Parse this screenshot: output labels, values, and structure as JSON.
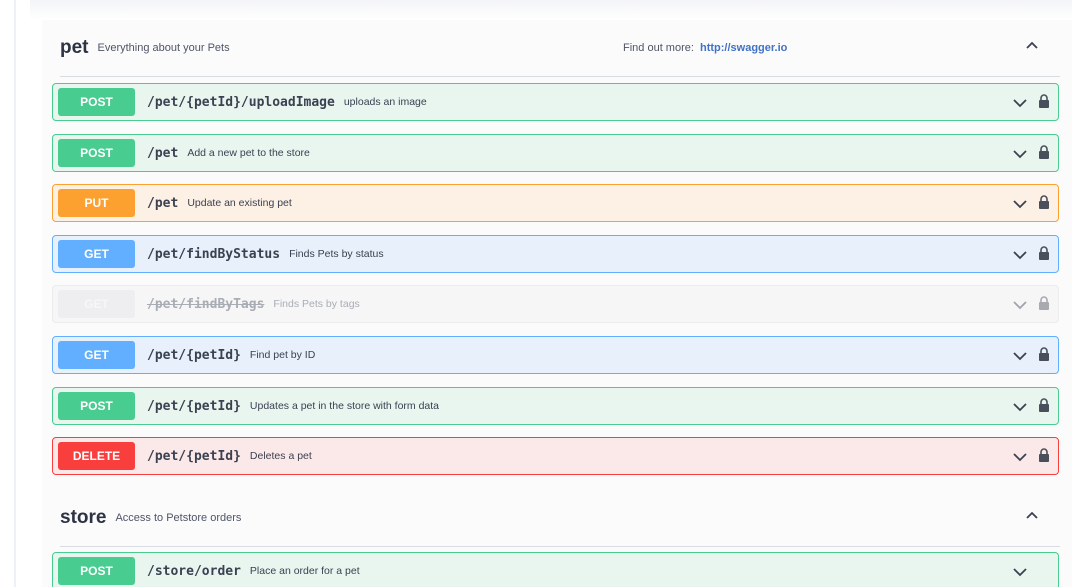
{
  "colors": {
    "post": "#49cc90",
    "put": "#fca130",
    "get": "#61affe",
    "delete": "#f93e3e",
    "link": "#4272c4"
  },
  "tags": {
    "pet": {
      "name": "pet",
      "description": "Everything about your Pets",
      "find_out_more_label": "Find out more:",
      "find_out_more_link": "http://swagger.io",
      "toggle_icon": "chevron-up-icon"
    },
    "store": {
      "name": "store",
      "description": "Access to Petstore orders",
      "toggle_icon": "chevron-up-icon"
    }
  },
  "operations": [
    {
      "method": "POST",
      "path": "/pet/{petId}/uploadImage",
      "summary": "uploads an image",
      "deprecated": false
    },
    {
      "method": "POST",
      "path": "/pet",
      "summary": "Add a new pet to the store",
      "deprecated": false
    },
    {
      "method": "PUT",
      "path": "/pet",
      "summary": "Update an existing pet",
      "deprecated": false
    },
    {
      "method": "GET",
      "path": "/pet/findByStatus",
      "summary": "Finds Pets by status",
      "deprecated": false
    },
    {
      "method": "GET",
      "path": "/pet/findByTags",
      "summary": "Finds Pets by tags",
      "deprecated": true
    },
    {
      "method": "GET",
      "path": "/pet/{petId}",
      "summary": "Find pet by ID",
      "deprecated": false
    },
    {
      "method": "POST",
      "path": "/pet/{petId}",
      "summary": "Updates a pet in the store with form data",
      "deprecated": false
    },
    {
      "method": "DELETE",
      "path": "/pet/{petId}",
      "summary": "Deletes a pet",
      "deprecated": false
    },
    {
      "method": "POST",
      "path": "/store/order",
      "summary": "Place an order for a pet",
      "deprecated": false
    }
  ]
}
